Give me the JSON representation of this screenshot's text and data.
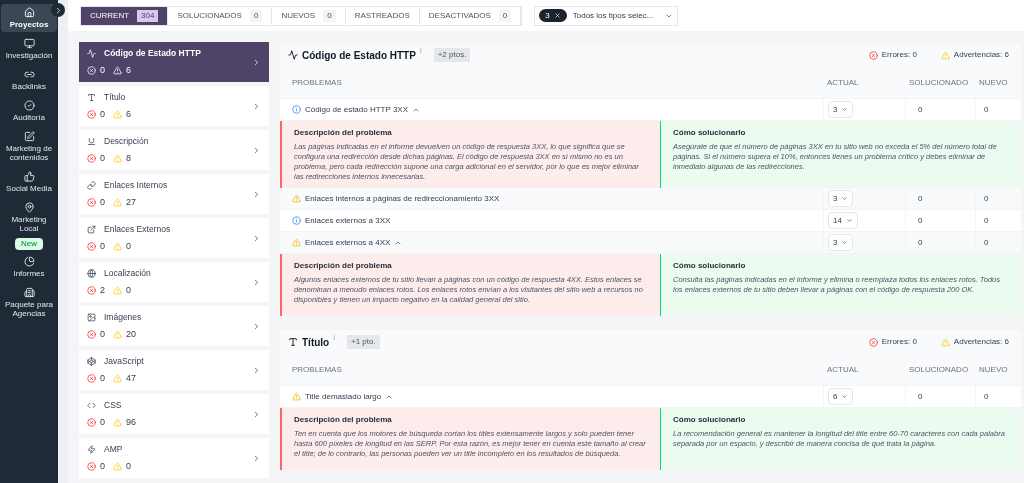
{
  "nav": [
    {
      "label": "Proyectos",
      "selected": true
    },
    {
      "label": "Investigación",
      "selected": false
    },
    {
      "label": "Backlinks",
      "selected": false
    },
    {
      "label": "Auditoría",
      "selected": false
    },
    {
      "label": "Marketing de contenidos",
      "selected": false
    },
    {
      "label": "Social Media",
      "selected": false
    },
    {
      "label": "Marketing Local",
      "selected": false,
      "badge": "New"
    },
    {
      "label": "Informes",
      "selected": false
    },
    {
      "label": "Paquete para Agencias",
      "selected": false
    }
  ],
  "tabs": [
    {
      "label": "CURRENT",
      "count": "304",
      "selected": true
    },
    {
      "label": "SOLUCIONADOS",
      "count": "0",
      "selected": false
    },
    {
      "label": "NUEVOS",
      "count": "0",
      "selected": false
    },
    {
      "label": "RASTREADOS",
      "selected": false
    },
    {
      "label": "DESACTIVADOS",
      "count": "0",
      "selected": false
    }
  ],
  "type_filter": {
    "count": "3",
    "value": "Todos los tipos selec..."
  },
  "categories": [
    {
      "title": "Código de Estado HTTP",
      "errors": "0",
      "warnings": "6",
      "selected": true
    },
    {
      "title": "Título",
      "errors": "0",
      "warnings": "6",
      "selected": false
    },
    {
      "title": "Descripción",
      "errors": "0",
      "warnings": "8",
      "selected": false
    },
    {
      "title": "Enlaces Internos",
      "errors": "0",
      "warnings": "27",
      "selected": false
    },
    {
      "title": "Enlaces Externos",
      "errors": "0",
      "warnings": "0",
      "selected": false
    },
    {
      "title": "Localización",
      "errors": "2",
      "warnings": "0",
      "selected": false
    },
    {
      "title": "Imágenes",
      "errors": "0",
      "warnings": "20",
      "selected": false
    },
    {
      "title": "JavaScript",
      "errors": "0",
      "warnings": "47",
      "selected": false
    },
    {
      "title": "CSS",
      "errors": "0",
      "warnings": "96",
      "selected": false
    },
    {
      "title": "AMP",
      "errors": "0",
      "warnings": "0",
      "selected": false
    }
  ],
  "sections": [
    {
      "title": "Código de Estado HTTP",
      "info_mark": "i",
      "points": "+2 ptos.",
      "errors": "Errores: 0",
      "warnings": "Advertencias: 6",
      "columns": [
        "PROBLEMAS",
        "ACTUAL",
        "SOLUCIONADO",
        "NUEVO"
      ],
      "rows": [
        {
          "kind": "info",
          "label": "Código de estado HTTP 3XX",
          "expanded": true,
          "actual": "3",
          "solved": "0",
          "new": "0",
          "description_title": "Descripción del problema",
          "description": "Las páginas indicadas en el informe devuelven un código de respuesta 3XX, lo que significa que se configura una redirección desde dichas páginas. El código de respuesta 3XX en sí mismo no es un problema, pero cada redirección supone una carga adicional en el servidor, por lo que es mejor eliminar las redirecciones internos innecesarias.",
          "solution_title": "Cómo solucionarlo",
          "solution": "Asegúrate de que el número de páginas 3XX en tu sitio web no exceda el 5% del número total de páginas. Si el número supera el 10%, entonces tienes un problema crítico y debes eliminar de inmediato algunas de las redirecciones."
        },
        {
          "kind": "warning",
          "label": "Enlaces internos a páginas de redireccionamiento 3XX",
          "expanded": false,
          "actual": "3",
          "solved": "0",
          "new": "0"
        },
        {
          "kind": "info",
          "label": "Enlaces externos a 3XX",
          "expanded": false,
          "actual": "14",
          "solved": "0",
          "new": "0"
        },
        {
          "kind": "warning",
          "label": "Enlaces externos a 4XX",
          "expanded": true,
          "actual": "3",
          "solved": "0",
          "new": "0",
          "description_title": "Descripción del problema",
          "description": "Algunos enlaces externos de tu sitio llevan a páginas con un código de respuesta 4XX. Estos enlaces se denominan a menudo enlaces rotos. Los enlaces rotos envían a los visitantes del sitio web a recursos no disponibles y tienen un impacto negativo en la calidad general del sitio.",
          "solution_title": "Cómo solucionarlo",
          "solution": "Consulta las páginas indicadas en el informe y elimina o reemplaza todos los enlaces rotos. Todos los enlaces externos de tu sitio deben llevar a páginas con el código de respuesta 200 OK."
        }
      ]
    },
    {
      "title": "Título",
      "info_mark": "i",
      "points": "+1 pto.",
      "errors": "Errores: 0",
      "warnings": "Advertencias: 6",
      "columns": [
        "PROBLEMAS",
        "ACTUAL",
        "SOLUCIONADO",
        "NUEVO"
      ],
      "rows": [
        {
          "kind": "warning",
          "label": "Title demasiado largo",
          "expanded": true,
          "actual": "6",
          "solved": "0",
          "new": "0",
          "description_title": "Descripción del problema",
          "description": "Ten en cuenta que los motores de búsqueda cortan los titles extensamente largos y solo pueden tener hasta 600 píxeles de longitud en las SERP. Por esta razón, es mejor tener en cuenta este tamaño al crear el title; de lo contrario, las personas pueden ver un title incompleto en los resultados de búsqueda.",
          "solution_title": "Cómo solucionarlo",
          "solution": "La recomendación general es mantener la longitud del title entre 60-70 caracteres con cada palabra separada por un espacio, y describir de manera concisa de qué trata la página."
        }
      ]
    }
  ]
}
